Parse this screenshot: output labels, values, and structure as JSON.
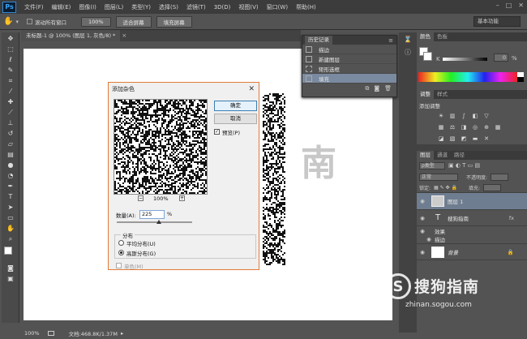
{
  "app": {
    "logo": "Ps"
  },
  "menu": [
    "文件(F)",
    "编辑(E)",
    "图像(I)",
    "图层(L)",
    "类型(Y)",
    "选择(S)",
    "滤镜(T)",
    "3D(D)",
    "视图(V)",
    "窗口(W)",
    "帮助(H)"
  ],
  "options_bar": {
    "scroll_all_windows": "滚动所有窗口",
    "btn_100": "100%",
    "btn_fit": "适合屏幕",
    "btn_fill": "填充屏幕",
    "workspace": "基本功能"
  },
  "document": {
    "tab_title": "未标题-1 @ 100% (图层 1, 灰色/8) *",
    "canvas_char": "南"
  },
  "status": {
    "zoom": "100%",
    "doc_info": "文档:468.8K/1.37M"
  },
  "history": {
    "tab": "历史记录",
    "items": [
      "描边",
      "新建图层",
      "矩形选框",
      "填充"
    ]
  },
  "color_panel": {
    "tabs": [
      "颜色",
      "色板"
    ],
    "k_label": "K",
    "k_value": "0",
    "k_unit": "%"
  },
  "adjust_panel": {
    "tabs": [
      "调整",
      "样式"
    ],
    "title": "添加调整"
  },
  "layers_panel": {
    "tabs": [
      "图层",
      "通道",
      "路径"
    ],
    "kind": "ρ类型",
    "mode": "正常",
    "opacity_label": "不透明度:",
    "lock_label": "锁定:",
    "fill_label": "填充:",
    "layers": [
      {
        "name": "图层 1"
      },
      {
        "name": "搜狗指南"
      },
      {
        "name": "效果"
      },
      {
        "name": "描边"
      },
      {
        "name": "背景"
      }
    ]
  },
  "dialog": {
    "title": "添加杂色",
    "ok": "确定",
    "cancel": "取消",
    "preview_label": "预览(P)",
    "zoom": "100%",
    "amount_label": "数量(A):",
    "amount_value": "225",
    "amount_unit": "%",
    "distribution_title": "分布",
    "uniform": "平均分布(U)",
    "gaussian": "高斯分布(G)",
    "mono": "单色(M)"
  },
  "watermark": {
    "text": "搜狗指南",
    "url": "zhinan.sogou.com"
  },
  "colors": {
    "accent": "#e07b39",
    "history_active": "#7a8aa0"
  }
}
